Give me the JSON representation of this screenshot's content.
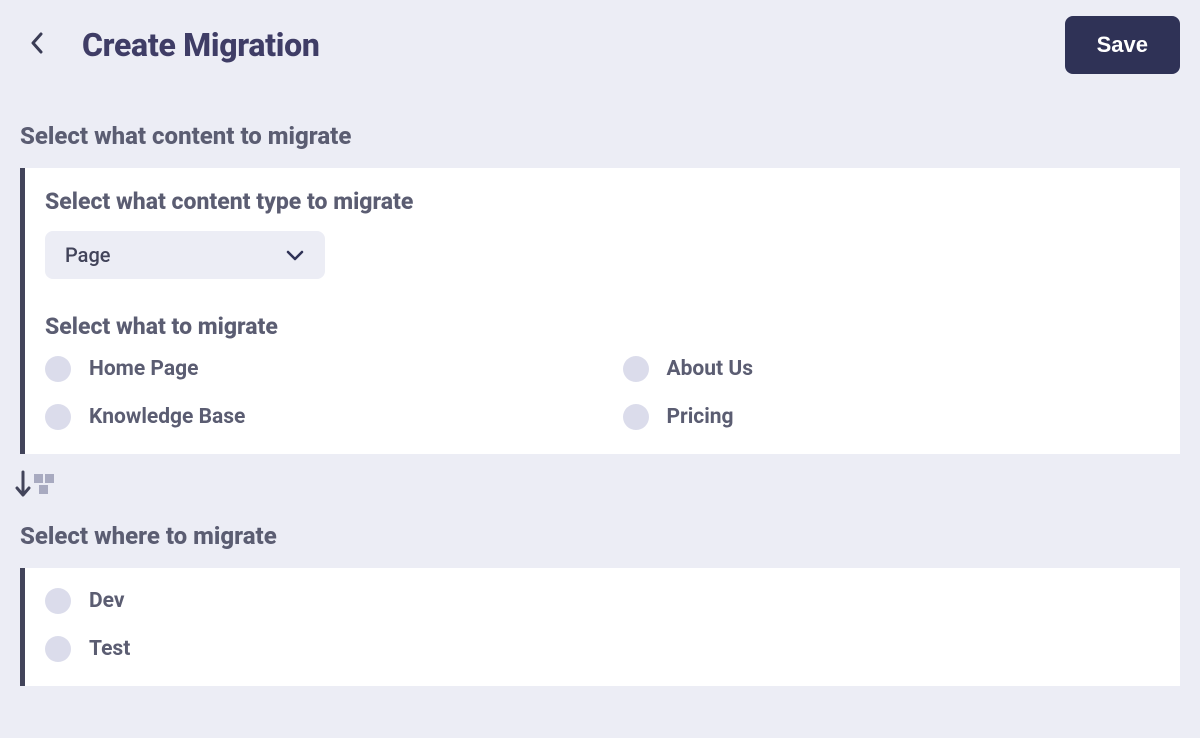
{
  "header": {
    "title": "Create Migration",
    "save_label": "Save"
  },
  "section_content_title": "Select what content to migrate",
  "content_type": {
    "heading": "Select what content type to migrate",
    "selected": "Page"
  },
  "what_to_migrate": {
    "heading": "Select what to migrate",
    "options": [
      "Home Page",
      "About Us",
      "Knowledge Base",
      "Pricing"
    ]
  },
  "section_where_title": "Select where to migrate",
  "destinations": {
    "options": [
      "Dev",
      "Test"
    ]
  }
}
